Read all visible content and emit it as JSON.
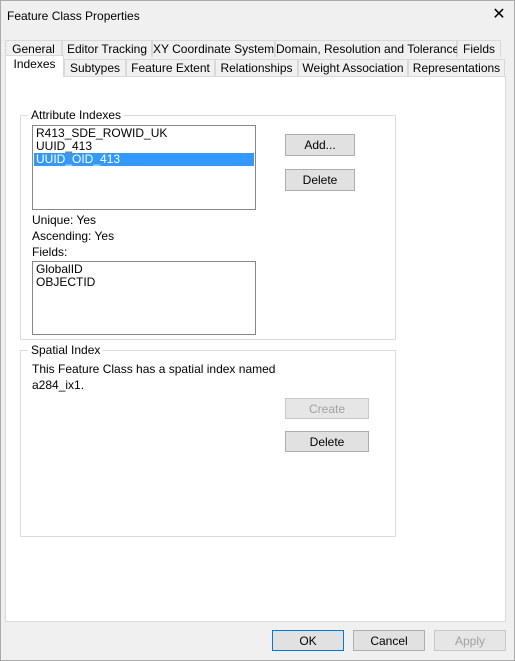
{
  "window": {
    "title": "Feature Class Properties",
    "close_icon": "close-icon"
  },
  "tabs_row1": [
    "General",
    "Editor Tracking",
    "XY Coordinate System",
    "Domain, Resolution and Tolerance",
    "Fields"
  ],
  "tabs_row2": [
    "Indexes",
    "Subtypes",
    "Feature Extent",
    "Relationships",
    "Weight Association",
    "Representations"
  ],
  "selected_tab": "Indexes",
  "attribute_indexes": {
    "label": "Attribute Indexes",
    "items": [
      "R413_SDE_ROWID_UK",
      "UUID_413",
      "UUID_OID_413"
    ],
    "selected": "UUID_OID_413",
    "add_label": "Add...",
    "delete_label": "Delete",
    "unique": "Unique: Yes",
    "ascending": "Ascending: Yes",
    "fields_label": "Fields:",
    "fields": [
      "GlobalID",
      "OBJECTID"
    ]
  },
  "spatial_index": {
    "label": "Spatial Index",
    "text_line1": "This Feature Class has a spatial index named",
    "text_line2": "a284_ix1.",
    "create_label": "Create",
    "delete_label": "Delete"
  },
  "footer": {
    "ok": "OK",
    "cancel": "Cancel",
    "apply": "Apply"
  },
  "colors": {
    "selection": "#3399ff",
    "default_button_border": "#0078d7"
  }
}
